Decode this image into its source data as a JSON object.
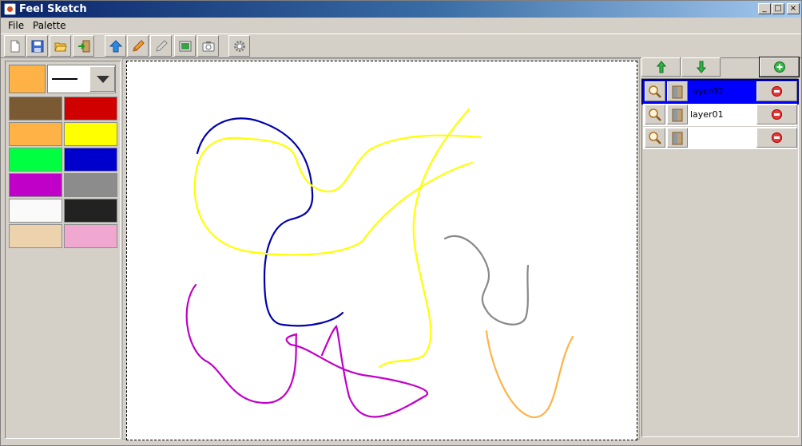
{
  "window": {
    "title": "Feel Sketch",
    "controls": {
      "minimize": "_",
      "maximize": "□",
      "close": "×"
    }
  },
  "menu": [
    "File",
    "Palette"
  ],
  "toolbar": {
    "icons": [
      "new-file-icon",
      "save-icon",
      "open-folder-icon",
      "exit-icon",
      "up-arrow-icon",
      "pencil-icon",
      "eraser-pencil-icon",
      "image-icon",
      "camera-icon",
      "gear-icon"
    ]
  },
  "palette": {
    "current_color": "#ffb347",
    "swatches": [
      "#7a5a32",
      "#d00000",
      "#ffb347",
      "#ffff00",
      "#00ff40",
      "#0000cc",
      "#c000c8",
      "#8c8c8c",
      "#fafafa",
      "#222222",
      "#ecd3ad",
      "#f0a8d0"
    ]
  },
  "layers": {
    "items": [
      {
        "name": "layer02",
        "selected": true
      },
      {
        "name": "layer01",
        "selected": false
      },
      {
        "name": "",
        "selected": false
      }
    ]
  },
  "canvas": {
    "strokes": [
      {
        "color": "#0000aa",
        "label": "blue-stroke"
      },
      {
        "color": "#ffff00",
        "label": "yellow-stroke"
      },
      {
        "color": "#c000c8",
        "label": "magenta-stroke"
      },
      {
        "color": "#888888",
        "label": "gray-stroke"
      },
      {
        "color": "#ffb347",
        "label": "orange-stroke"
      }
    ]
  }
}
